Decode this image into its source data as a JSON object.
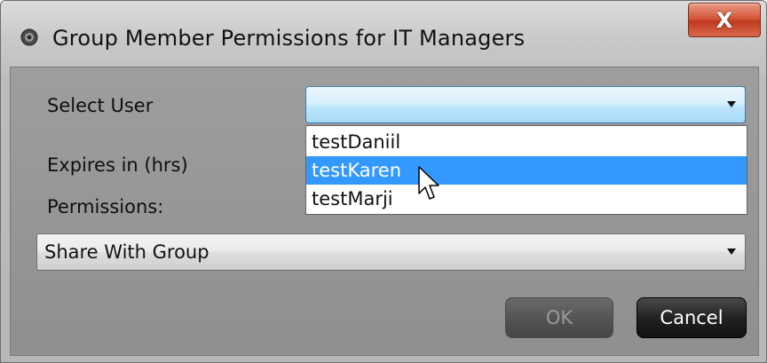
{
  "window": {
    "title": "Group Member Permissions for IT Managers",
    "close_label": "X"
  },
  "form": {
    "select_user_label": "Select User",
    "select_user_value": "",
    "expires_label": "Expires in (hrs)",
    "permissions_label": "Permissions:",
    "permissions_value": "Share With Group"
  },
  "user_dropdown": {
    "items": [
      "testDaniil",
      "testKaren",
      "testMarji"
    ],
    "selected": "testKaren"
  },
  "buttons": {
    "ok_label": "OK",
    "cancel_label": "Cancel"
  },
  "colors": {
    "highlight": "#3399ff",
    "close_button": "#c9472b"
  }
}
